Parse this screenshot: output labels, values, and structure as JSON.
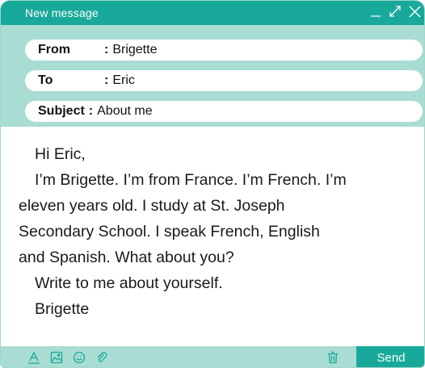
{
  "window": {
    "title": "New message",
    "controls": [
      "minimize-icon",
      "expand-icon",
      "close-icon"
    ]
  },
  "fields": {
    "from": {
      "label": "From",
      "colon": ":",
      "value": "Brigette"
    },
    "to": {
      "label": "To",
      "colon": ":",
      "value": "Eric"
    },
    "subject": {
      "label": "Subject",
      "colon": ":",
      "value": "About me"
    }
  },
  "body": {
    "greeting": "Hi Eric,",
    "line1": "I’m Brigette. I’m from France. I’m French. I’m",
    "line2": "eleven years old. I study at St. Joseph",
    "line3": "Secondary School. I speak French, English",
    "line4": "and Spanish. What about you?",
    "line5": "Write to me about yourself.",
    "signature": "Brigette"
  },
  "toolbar": {
    "tools": [
      "text-format-icon",
      "image-icon",
      "emoji-icon",
      "attachment-icon"
    ],
    "delete_icon": "trash-icon",
    "send_label": "Send"
  },
  "colors": {
    "accent": "#19a99a",
    "panel": "#a9dcd2"
  }
}
